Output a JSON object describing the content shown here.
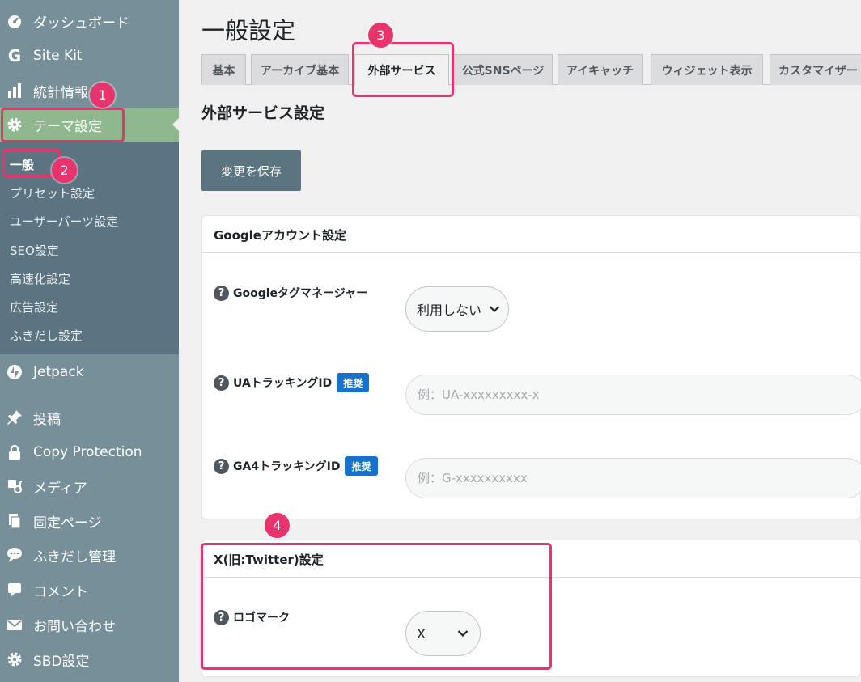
{
  "sidebar": {
    "items": [
      {
        "label": "ダッシュボード",
        "icon": "dashboard-icon"
      },
      {
        "label": "Site Kit",
        "icon": "google-g-icon"
      },
      {
        "label": "統計情報",
        "icon": "bar-chart-icon"
      },
      {
        "label": "テーマ設定",
        "icon": "gear-icon"
      },
      {
        "label": "Jetpack",
        "icon": "jetpack-icon"
      },
      {
        "label": "投稿",
        "icon": "pin-icon"
      },
      {
        "label": "Copy Protection",
        "icon": "lock-icon"
      },
      {
        "label": "メディア",
        "icon": "media-icon"
      },
      {
        "label": "固定ページ",
        "icon": "pages-icon"
      },
      {
        "label": "ふきだし管理",
        "icon": "speech-bubble-icon"
      },
      {
        "label": "コメント",
        "icon": "comment-icon"
      },
      {
        "label": "お問い合わせ",
        "icon": "envelope-icon"
      },
      {
        "label": "SBD設定",
        "icon": "gear-icon"
      }
    ],
    "submenu": [
      "一般",
      "プリセット設定",
      "ユーザーパーツ設定",
      "SEO設定",
      "高速化設定",
      "広告設定",
      "ふきだし設定"
    ]
  },
  "main": {
    "title": "一般設定",
    "tabs": [
      "基本",
      "アーカイブ基本",
      "外部サービス",
      "公式SNSページ",
      "アイキャッチ",
      "ウィジェット表示",
      "カスタマイザー"
    ],
    "active_tab": "外部サービス",
    "section_title": "外部サービス設定",
    "save_button": "変更を保存"
  },
  "google_panel": {
    "title": "Googleアカウント設定",
    "help": "?",
    "tag_manager_label": "Googleタグマネージャー",
    "tag_manager_value": "利用しない",
    "ua_label": "UAトラッキングID",
    "ua_badge": "推奨",
    "ua_placeholder": "例：UA-xxxxxxxxx-x",
    "ga4_label": "GA4トラッキングID",
    "ga4_badge": "推奨",
    "ga4_placeholder": "例：G-xxxxxxxxxx"
  },
  "x_panel": {
    "title": "X(旧:Twitter)設定",
    "logo_label": "ロゴマーク",
    "logo_value": "X"
  },
  "annotations": [
    "1",
    "2",
    "3",
    "4"
  ],
  "colors": {
    "sidebar": "#778f99",
    "submenu": "#5c7481",
    "active_menu": "#8fb88e",
    "highlight": "#e8336d",
    "badge": "#1571c9",
    "save_button": "#5a7480"
  }
}
